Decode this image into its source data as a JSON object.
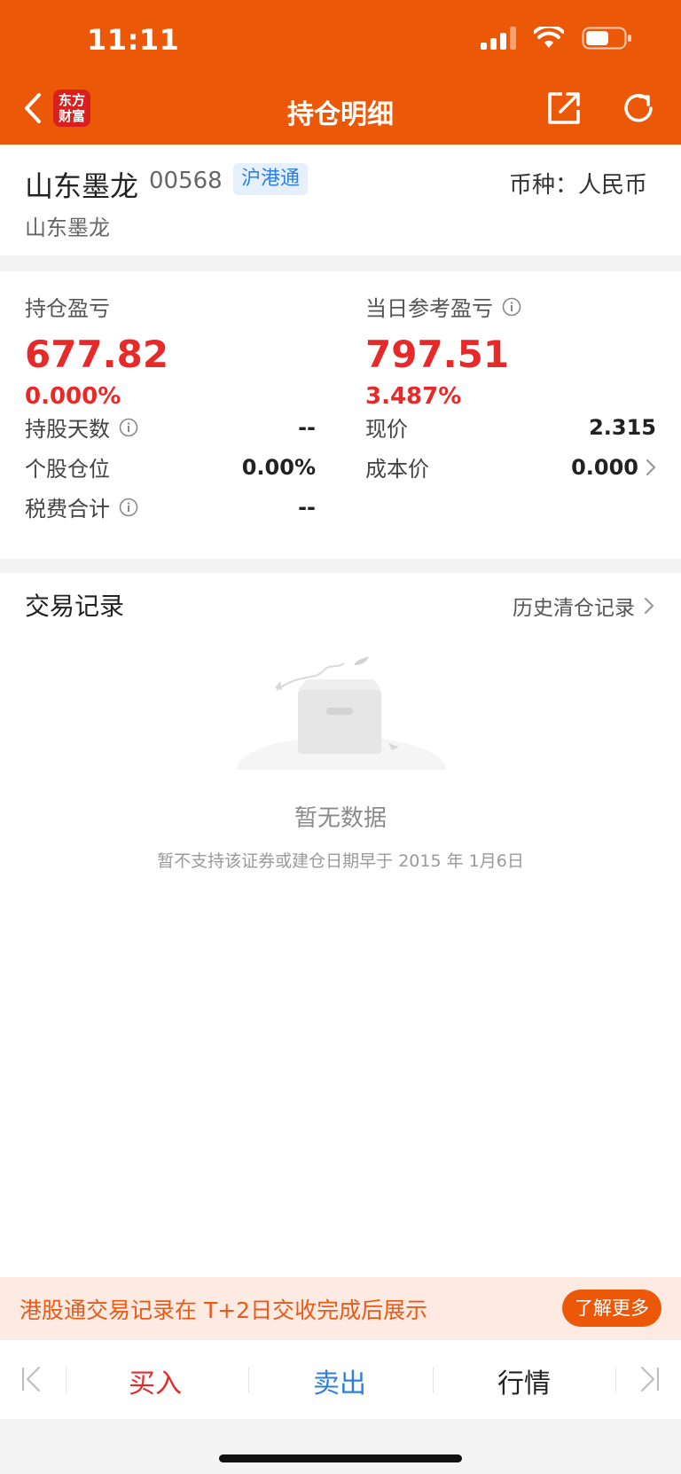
{
  "status_bar": {
    "time": "11:11"
  },
  "nav": {
    "title": "持仓明细",
    "brand_line1": "东方",
    "brand_line2": "财富"
  },
  "stock": {
    "name": "山东墨龙",
    "code": "00568",
    "market_badge": "沪港通",
    "currency_label": "币种：人民币",
    "subtitle": "山东墨龙"
  },
  "pl": {
    "holding_label": "持仓盈亏",
    "holding_value": "677.82",
    "holding_pct": "0.000%",
    "daily_label": "当日参考盈亏",
    "daily_value": "797.51",
    "daily_pct": "3.487%"
  },
  "details": {
    "hold_days_label": "持股天数",
    "hold_days_value": "--",
    "position_label": "个股仓位",
    "position_value": "0.00%",
    "fees_label": "税费合计",
    "fees_value": "--",
    "price_label": "现价",
    "price_value": "2.315",
    "cost_label": "成本价",
    "cost_value": "0.000"
  },
  "trade": {
    "title": "交易记录",
    "history_link": "历史清仓记录",
    "empty_title": "暂无数据",
    "empty_sub": "暂不支持该证券或建仓日期早于 2015 年 1月6日"
  },
  "notice": {
    "text": "港股通交易记录在 T+2日交收完成后展示",
    "button": "了解更多"
  },
  "actions": {
    "buy": "买入",
    "sell": "卖出",
    "quote": "行情"
  },
  "colors": {
    "brand": "#eb5807",
    "up_red": "#e62a2a",
    "sell_blue": "#2f7fdc"
  }
}
